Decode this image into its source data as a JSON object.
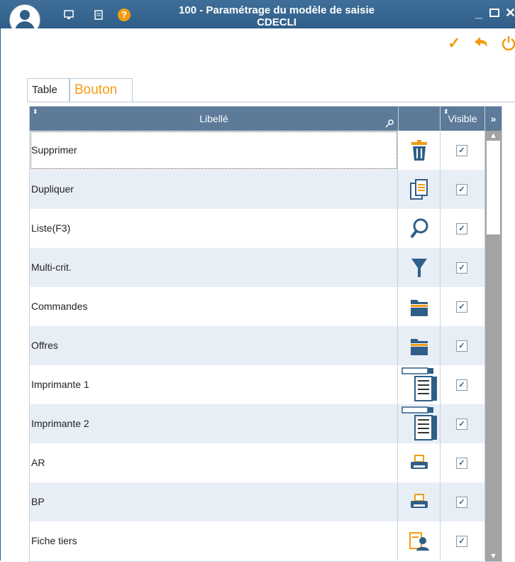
{
  "window": {
    "title_line1": "100 - Paramétrage du modèle de saisie",
    "title_line2": "CDECLI"
  },
  "tabs": [
    {
      "label": "Table",
      "active": false
    },
    {
      "label": "Bouton",
      "active": true
    }
  ],
  "grid": {
    "columns": {
      "libelle": "Libellé",
      "icon": "",
      "visible": "Visible"
    },
    "rows": [
      {
        "libelle": "Supprimer",
        "icon": "trash-icon",
        "visible": true
      },
      {
        "libelle": "Dupliquer",
        "icon": "duplicate-icon",
        "visible": true
      },
      {
        "libelle": "Liste(F3)",
        "icon": "magnifier-icon",
        "visible": true
      },
      {
        "libelle": "Multi-crit.",
        "icon": "filter-funnel-icon",
        "visible": true
      },
      {
        "libelle": "Commandes",
        "icon": "folder-icon",
        "visible": true
      },
      {
        "libelle": "Offres",
        "icon": "folder-icon",
        "visible": true
      },
      {
        "libelle": "Imprimante 1",
        "icon": "list-form-icon",
        "visible": true
      },
      {
        "libelle": "Imprimante 2",
        "icon": "list-form-icon",
        "visible": true
      },
      {
        "libelle": "AR",
        "icon": "printer-icon",
        "visible": true
      },
      {
        "libelle": "BP",
        "icon": "printer-icon",
        "visible": true
      },
      {
        "libelle": "Fiche tiers",
        "icon": "contact-card-icon",
        "visible": true
      }
    ]
  },
  "colors": {
    "accent": "#f39c12",
    "header": "#5d7a99",
    "titlebar": "#2f5e88"
  }
}
